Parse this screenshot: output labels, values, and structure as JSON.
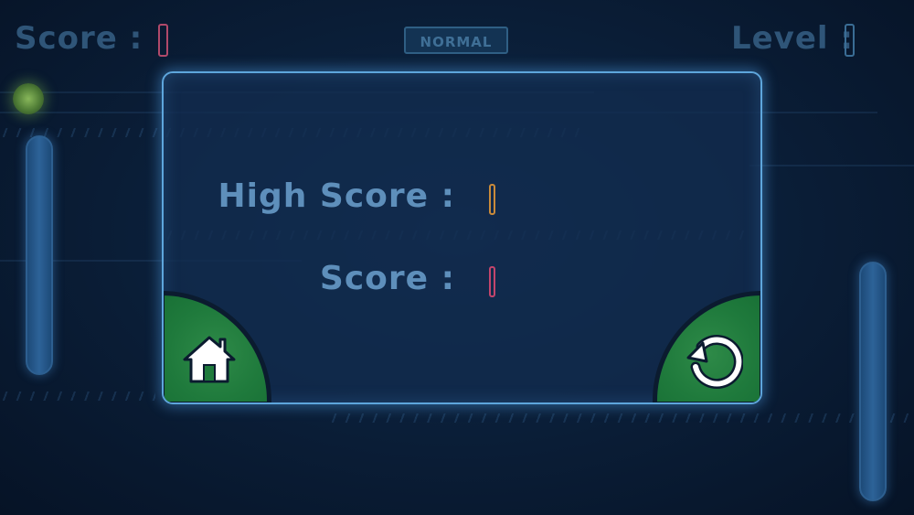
{
  "hud": {
    "score_label": "Score :",
    "level_label": "Level :",
    "mode": "NORMAL"
  },
  "dialog": {
    "high_score_label": "High Score :",
    "score_label": "Score :"
  },
  "buttons": {
    "home_icon": "home-icon",
    "replay_icon": "replay-icon"
  },
  "colors": {
    "panel_border": "#5ea6dc",
    "button_green": "#1f7a3c",
    "high_score_marker": "#c98a3a",
    "score_marker": "#c2456c"
  }
}
